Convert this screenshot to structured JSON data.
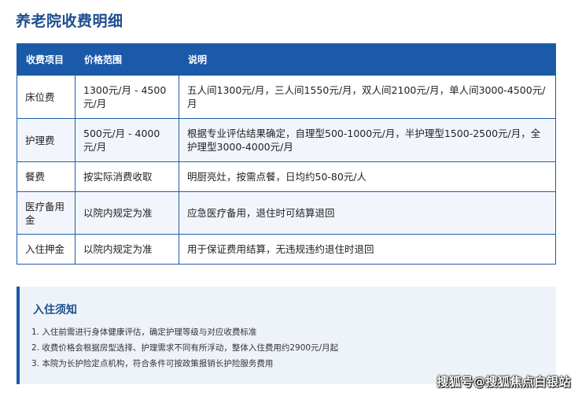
{
  "page": {
    "title": "养老院收费明细"
  },
  "table": {
    "headers": [
      "收费项目",
      "价格范围",
      "说明"
    ],
    "rows": [
      {
        "item": "床位费",
        "price": "1300元/月 - 4500元/月",
        "desc": "五人间1300元/月，三人间1550元/月，双人间2100元/月，单人间3000-4500元/月"
      },
      {
        "item": "护理费",
        "price": "500元/月 - 4000元/月",
        "desc": "根据专业评估结果确定，自理型500-1000元/月，半护理型1500-2500元/月，全护理型3000-4000元/月"
      },
      {
        "item": "餐费",
        "price": "按实际消费收取",
        "desc": "明厨亮灶，按需点餐，日均约50-80元/人"
      },
      {
        "item": "医疗备用金",
        "price": "以院内规定为准",
        "desc": "应急医疗备用，退住时可结算退回"
      },
      {
        "item": "入住押金",
        "price": "以院内规定为准",
        "desc": "用于保证费用结算，无违规违约退住时退回"
      }
    ]
  },
  "notice": {
    "title": "入住须知",
    "items": [
      "1. 入住前需进行身体健康评估，确定护理等级与对应收费标准",
      "2. 收费价格会根据房型选择、护理需求不同有所浮动，整体入住费用约2900元/月起",
      "3. 本院为长护险定点机构，符合条件可按政策报销长护险服务费用"
    ]
  },
  "watermark": {
    "text": "搜狐号@搜狐焦点白银站"
  },
  "colors": {
    "header_bg": "#1a5aa8",
    "title": "#1f4e8c",
    "alt_row": "#f2f6fc",
    "notice_bg": "#eef3fa"
  }
}
